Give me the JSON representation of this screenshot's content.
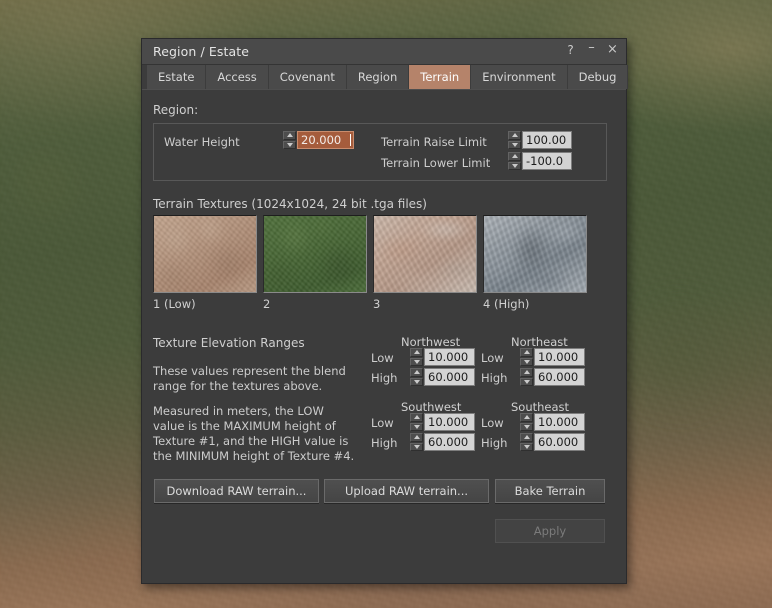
{
  "window": {
    "title": "Region / Estate",
    "controls": {
      "help": "?",
      "minimize": "–",
      "close": "×"
    }
  },
  "tabs": [
    {
      "label": "Estate",
      "active": false
    },
    {
      "label": "Access",
      "active": false
    },
    {
      "label": "Covenant",
      "active": false
    },
    {
      "label": "Region",
      "active": false
    },
    {
      "label": "Terrain",
      "active": true
    },
    {
      "label": "Environment",
      "active": false
    },
    {
      "label": "Debug",
      "active": false
    }
  ],
  "region_section": {
    "heading": "Region:",
    "water_height": {
      "label": "Water Height",
      "value": "20.000",
      "focused": true
    },
    "terrain_raise_limit": {
      "label": "Terrain Raise Limit",
      "value": "100.00"
    },
    "terrain_lower_limit": {
      "label": "Terrain Lower Limit",
      "value": "-100.0"
    }
  },
  "terrain_textures": {
    "heading": "Terrain Textures (1024x1024, 24 bit .tga files)",
    "swatches": [
      {
        "caption": "1 (Low)",
        "kind": "sand-texture"
      },
      {
        "caption": "2",
        "kind": "grass-texture"
      },
      {
        "caption": "3",
        "kind": "rock-texture"
      },
      {
        "caption": "4 (High)",
        "kind": "stone-texture"
      }
    ]
  },
  "elevation_ranges": {
    "heading": "Texture Elevation Ranges",
    "description_1": "These values represent the blend range for the textures above.",
    "description_2": "Measured in meters, the LOW value is the MAXIMUM height of Texture #1, and the HIGH value is the MINIMUM height of Texture #4.",
    "low_label": "Low",
    "high_label": "High",
    "quadrants": [
      {
        "name": "Northwest",
        "low": "10.000",
        "high": "60.000"
      },
      {
        "name": "Northeast",
        "low": "10.000",
        "high": "60.000"
      },
      {
        "name": "Southwest",
        "low": "10.000",
        "high": "60.000"
      },
      {
        "name": "Southeast",
        "low": "10.000",
        "high": "60.000"
      }
    ]
  },
  "buttons": {
    "download_raw": "Download RAW terrain...",
    "upload_raw": "Upload RAW terrain...",
    "bake_terrain": "Bake Terrain",
    "apply": "Apply",
    "apply_disabled": true
  },
  "colors": {
    "window_bg": "#3c3c3c",
    "titlebar_bg": "#4a4a4a",
    "tab_bg": "#4a4a4a",
    "tab_active_bg": "#b5836a",
    "field_bg": "#d3d3d3",
    "field_focused_bg": "#a55c3c",
    "text": "#d6d6d6"
  }
}
